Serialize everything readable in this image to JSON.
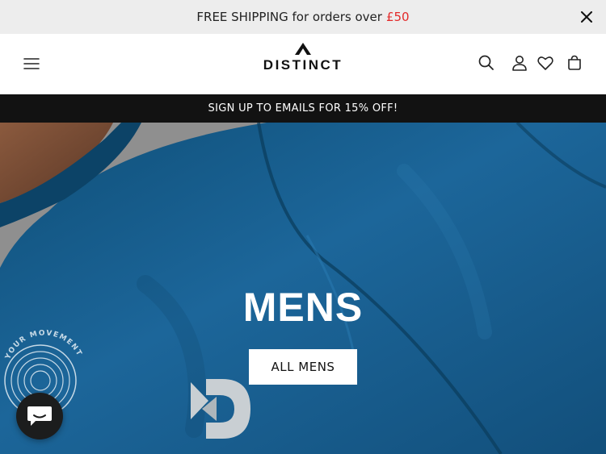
{
  "announcement": {
    "text": "FREE SHIPPING for orders over",
    "price": "£50",
    "price_color": "#e32a2a",
    "close_icon": "close-icon"
  },
  "header": {
    "menu_icon": "hamburger-menu-icon",
    "logo_text": "DISTINCT",
    "icons": [
      "search-icon",
      "account-icon",
      "wishlist-heart-icon",
      "cart-icon"
    ]
  },
  "promo": {
    "text": "SIGN UP TO EMAILS FOR 15% OFF!"
  },
  "hero": {
    "title": "MENS",
    "button_label": "ALL MENS",
    "badge_text": "YOUR MOVEMENT",
    "brand_color": "#1b5e88"
  },
  "chat": {
    "icon": "chat-bubble-icon"
  }
}
